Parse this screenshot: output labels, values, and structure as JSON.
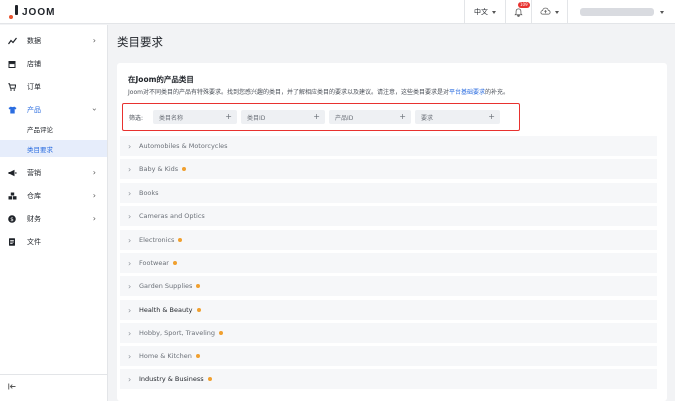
{
  "topbar": {
    "logo_text": "JOOM",
    "language": "中文",
    "notification_count": "109"
  },
  "sidebar": {
    "items": [
      {
        "label": "数据",
        "icon": "trend-chart-icon",
        "has_chevron": true
      },
      {
        "label": "店铺",
        "icon": "store-icon",
        "has_chevron": false
      },
      {
        "label": "订单",
        "icon": "order-cart-icon",
        "has_chevron": false
      },
      {
        "label": "产品",
        "icon": "shirt-icon",
        "has_chevron": true,
        "expanded": true
      },
      {
        "label": "营销",
        "icon": "megaphone-icon",
        "has_chevron": true
      },
      {
        "label": "仓库",
        "icon": "warehouse-icon",
        "has_chevron": true
      },
      {
        "label": "财务",
        "icon": "dollar-icon",
        "has_chevron": true
      },
      {
        "label": "文件",
        "icon": "document-icon",
        "has_chevron": false
      }
    ],
    "sub_items": [
      {
        "label": "产品评论",
        "selected": false
      },
      {
        "label": "类目要求",
        "selected": true
      }
    ]
  },
  "page": {
    "title": "类目要求"
  },
  "card": {
    "title": "在Joom的产品类目",
    "description_prefix": "Joom对不同类目的产品有特殊要求。找到您感兴趣的类目，并了解相应类目的要求以及建议。请注意，这些类目要求是对",
    "description_link": "平台基础要求",
    "description_suffix": "的补充。"
  },
  "filters": {
    "label": "筛选:",
    "chips": [
      "类目名称",
      "类目ID",
      "产品ID",
      "要求"
    ]
  },
  "colors": {
    "accent": "#2b6de0",
    "highlight_border": "#e8322f",
    "status_dot": "#f0a030"
  },
  "categories": [
    {
      "name": "Automobiles & Motorcycles",
      "dot": false,
      "dark": false
    },
    {
      "name": "Baby & Kids",
      "dot": true,
      "dark": false
    },
    {
      "name": "Books",
      "dot": false,
      "dark": false
    },
    {
      "name": "Cameras and Optics",
      "dot": false,
      "dark": false
    },
    {
      "name": "Electronics",
      "dot": true,
      "dark": false
    },
    {
      "name": "Footwear",
      "dot": true,
      "dark": false
    },
    {
      "name": "Garden Supplies",
      "dot": true,
      "dark": false
    },
    {
      "name": "Health & Beauty",
      "dot": true,
      "dark": true
    },
    {
      "name": "Hobby, Sport, Traveling",
      "dot": true,
      "dark": false
    },
    {
      "name": "Home & Kitchen",
      "dot": true,
      "dark": false
    },
    {
      "name": "Industry & Business",
      "dot": true,
      "dark": true
    }
  ]
}
